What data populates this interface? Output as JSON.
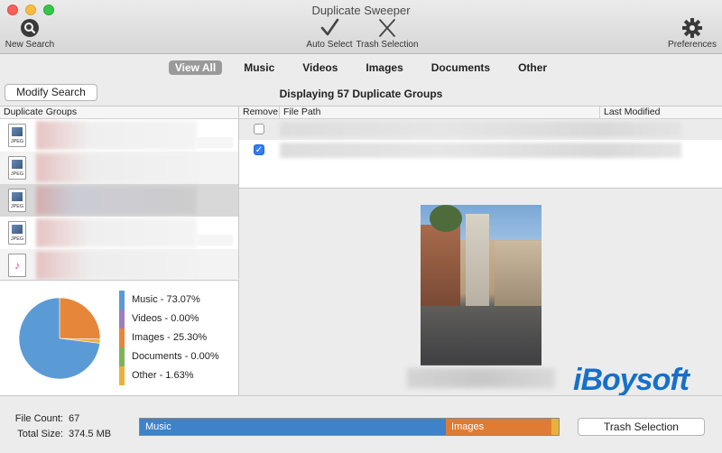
{
  "window": {
    "title": "Duplicate Sweeper"
  },
  "toolbar": {
    "new_search": "New Search",
    "auto_select": "Auto Select",
    "trash_selection": "Trash Selection",
    "preferences": "Preferences"
  },
  "filters": [
    {
      "label": "View All",
      "active": true
    },
    {
      "label": "Music",
      "active": false
    },
    {
      "label": "Videos",
      "active": false
    },
    {
      "label": "Images",
      "active": false
    },
    {
      "label": "Documents",
      "active": false
    },
    {
      "label": "Other",
      "active": false
    }
  ],
  "modify_search": "Modify Search",
  "display_title": "Displaying 57 Duplicate Groups",
  "left_list": {
    "header": "Duplicate Groups",
    "items": [
      {
        "icon": "jpeg-file-icon",
        "type": "JPEG"
      },
      {
        "icon": "jpeg-file-icon",
        "type": "JPEG"
      },
      {
        "icon": "jpeg-file-icon",
        "type": "JPEG",
        "selected": true
      },
      {
        "icon": "jpeg-file-icon",
        "type": "JPEG"
      },
      {
        "icon": "music-file-icon",
        "type": "♪"
      }
    ]
  },
  "right_list": {
    "headers": {
      "remove": "Remove",
      "path": "File Path",
      "modified": "Last Modified"
    },
    "rows": [
      {
        "checked": false,
        "check_glyph": ""
      },
      {
        "checked": true,
        "check_glyph": "✓"
      }
    ]
  },
  "watermark": "iBoysoft",
  "chart_data": {
    "type": "pie",
    "categories": [
      "Music",
      "Videos",
      "Images",
      "Documents",
      "Other"
    ],
    "values": [
      73.07,
      0.0,
      25.3,
      0.0,
      1.63
    ],
    "colors": [
      "#5b9bd5",
      "#9b7fbf",
      "#e5863b",
      "#7fb25a",
      "#e8b23a"
    ],
    "legend": [
      "Music - 73.07%",
      "Videos - 0.00%",
      "Images - 25.30%",
      "Documents - 0.00%",
      "Other - 1.63%"
    ]
  },
  "footer": {
    "file_count_label": "File Count:",
    "file_count_value": "67",
    "total_size_label": "Total Size:",
    "total_size_value": "374.5 MB",
    "bar_segments": [
      {
        "label": "Music",
        "percent": 73.07,
        "color": "#3e82c9"
      },
      {
        "label": "Images",
        "percent": 25.3,
        "color": "#e07b33"
      },
      {
        "label": "",
        "percent": 1.63,
        "color": "#e8b23a"
      }
    ],
    "trash_button": "Trash Selection"
  }
}
